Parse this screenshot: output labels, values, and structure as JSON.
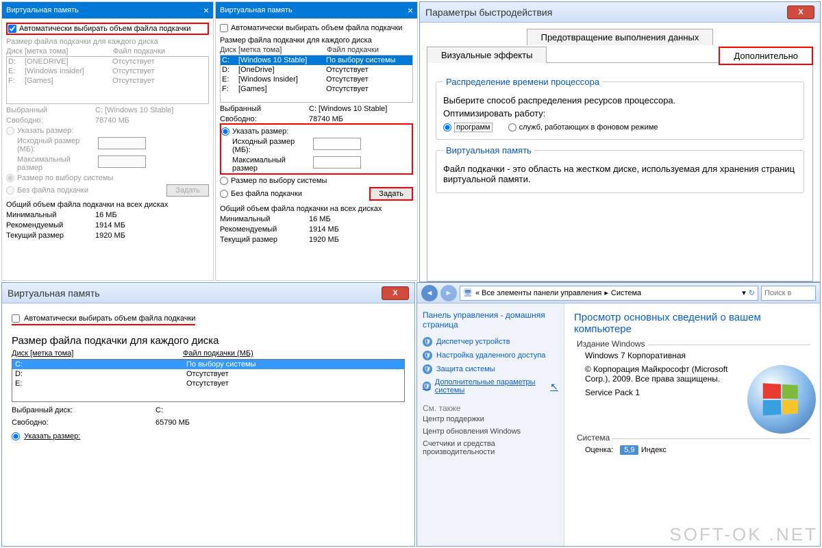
{
  "panelA": {
    "title": "Виртуальная память",
    "auto_chk": "Автоматически выбирать объем файла подкачки",
    "auto_checked": true,
    "group_title": "Размер файла подкачки для каждого диска",
    "col_disk": "Диск [метка тома]",
    "col_file": "Файл подкачки",
    "rows": [
      {
        "d": "D:",
        "l": "[ONEDRIVE]",
        "f": "Отсутствует"
      },
      {
        "d": "E:",
        "l": "[Windows Insider]",
        "f": "Отсутствует"
      },
      {
        "d": "F:",
        "l": "[Games]",
        "f": "Отсутствует"
      }
    ],
    "selected_lbl": "Выбранный",
    "selected_val": "C: [Windows 10 Stable]",
    "free_lbl": "Свободно:",
    "free_val": "78740 МБ",
    "rad_custom": "Указать размер:",
    "initial_lbl": "Исходный размер (МБ):",
    "max_lbl": "Максимальный размер",
    "rad_system": "Размер по выбору системы",
    "rad_none": "Без файла подкачки",
    "btn_set": "Задать",
    "total_title": "Общий объем файла подкачки на всех дисках",
    "min_lbl": "Минимальный",
    "min_val": "16 МБ",
    "rec_lbl": "Рекомендуемый",
    "rec_val": "1914 МБ",
    "cur_lbl": "Текущий размер",
    "cur_val": "1920 МБ"
  },
  "panelB": {
    "title": "Виртуальная память",
    "auto_chk": "Автоматически выбирать объем файла подкачки",
    "auto_checked": false,
    "group_title": "Размер файла подкачки для каждого диска",
    "col_disk": "Диск [метка тома]",
    "col_file": "Файл подкачки",
    "rows": [
      {
        "d": "C:",
        "l": "[Windows 10 Stable]",
        "f": "По выбору системы",
        "sel": true
      },
      {
        "d": "D:",
        "l": "[OneDrive]",
        "f": "Отсутствует"
      },
      {
        "d": "E:",
        "l": "[Windows Insider]",
        "f": "Отсутствует"
      },
      {
        "d": "F:",
        "l": "[Games]",
        "f": "Отсутствует"
      }
    ],
    "selected_lbl": "Выбранный",
    "selected_val": "C: [Windows 10 Stable]",
    "free_lbl": "Свободно:",
    "free_val": "78740 МБ",
    "rad_custom": "Указать размер:",
    "initial_lbl": "Исходный размер (МБ):",
    "max_lbl": "Максимальный размер",
    "rad_system": "Размер по выбору системы",
    "rad_none": "Без файла подкачки",
    "btn_set": "Задать",
    "total_title": "Общий объем файла подкачки на всех дисках",
    "min_lbl": "Минимальный",
    "min_val": "16 МБ",
    "rec_lbl": "Рекомендуемый",
    "rec_val": "1914 МБ",
    "cur_lbl": "Текущий размер",
    "cur_val": "1920 МБ"
  },
  "panelC": {
    "title": "Параметры быстродействия",
    "tab_dep": "Предотвращение выполнения данных",
    "tab_vis": "Визуальные эффекты",
    "tab_adv": "Дополнительно",
    "sched_legend": "Распределение времени процессора",
    "sched_text": "Выберите способ распределения ресурсов процессора.",
    "opt_lbl": "Оптимизировать работу:",
    "opt_prog": "программ",
    "opt_bg": "служб, работающих в фоновом режиме",
    "vm_legend": "Виртуальная память",
    "vm_text": "Файл подкачки - это область на жестком диске, используемая для хранения страниц виртуальной памяти."
  },
  "panelD": {
    "title": "Виртуальная память",
    "auto_chk": "Автоматически выбирать объем файла подкачки",
    "group_title": "Размер файла подкачки для каждого диска",
    "col_disk": "Диск [метка тома]",
    "col_file": "Файл подкачки (МБ)",
    "rows": [
      {
        "d": "C:",
        "f": "По выбору системы",
        "sel": true
      },
      {
        "d": "D:",
        "f": "Отсутствует"
      },
      {
        "d": "E:",
        "f": "Отсутствует"
      }
    ],
    "sel_lbl": "Выбранный диск:",
    "sel_val": "C:",
    "free_lbl": "Свободно:",
    "free_val": "65790 МБ",
    "rad_custom": "Указать размер:"
  },
  "panelE": {
    "breadcrumb_pre": "« Все элементы панели управления",
    "breadcrumb_cur": "Система",
    "search_ph": "Поиск в",
    "side_title": "Панель управления - домашняя страница",
    "links": [
      "Диспетчер устройств",
      "Настройка удаленного доступа",
      "Защита системы",
      "Дополнительные параметры системы"
    ],
    "see_also": "См. также",
    "grey_links": [
      "Центр поддержки",
      "Центр обновления Windows",
      "Счетчики и средства производительности"
    ],
    "main_title": "Просмотр основных сведений о вашем компьютере",
    "edition_legend": "Издание Windows",
    "edition_name": "Windows 7 Корпоративная",
    "copyright": "© Корпорация Майкрософт (Microsoft Corp.), 2009. Все права защищены.",
    "sp": "Service Pack 1",
    "system_legend": "Система",
    "rating_lbl": "Оценка:",
    "rating_val": "5,9",
    "rating_sub": "Индекс"
  },
  "watermark": "SOFT-OK .NET"
}
